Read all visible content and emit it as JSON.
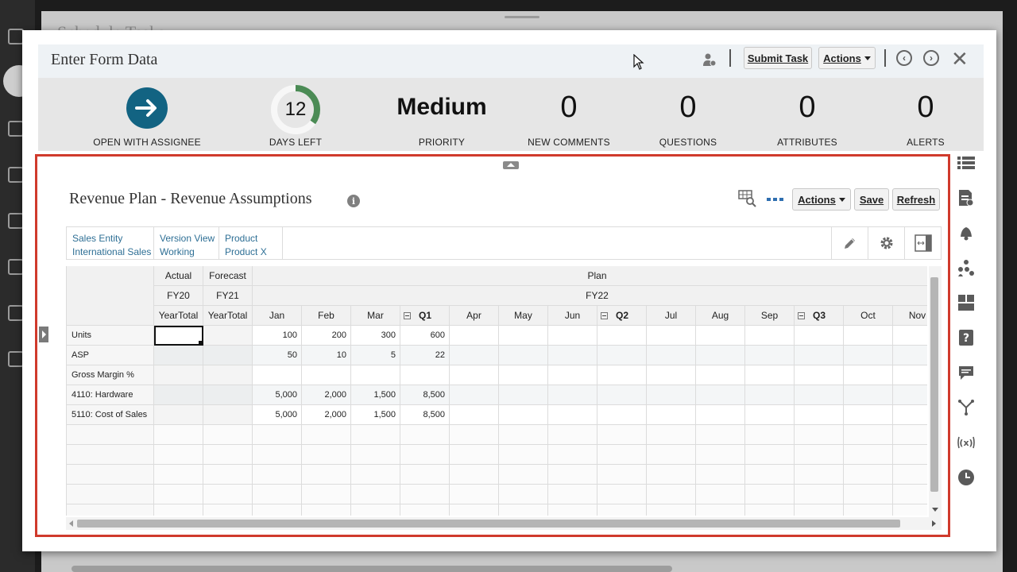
{
  "background": {
    "title": "Schedule Tasks"
  },
  "dialog": {
    "title": "Enter Form Data",
    "submit_label": "Submit Task",
    "actions_label": "Actions"
  },
  "stats": {
    "open_label": "OPEN WITH ASSIGNEE",
    "days_left": {
      "value": "12",
      "label": "DAYS LEFT",
      "fraction": 0.35
    },
    "priority": {
      "value": "Medium",
      "label": "PRIORITY"
    },
    "comments": {
      "value": "0",
      "label": "NEW COMMENTS"
    },
    "questions": {
      "value": "0",
      "label": "QUESTIONS"
    },
    "attributes": {
      "value": "0",
      "label": "ATTRIBUTES"
    },
    "alerts": {
      "value": "0",
      "label": "ALERTS"
    }
  },
  "form": {
    "title": "Revenue Plan - Revenue Assumptions",
    "actions_label": "Actions",
    "save_label": "Save",
    "refresh_label": "Refresh",
    "pov": [
      {
        "dim": "Sales Entity",
        "member": "International Sales"
      },
      {
        "dim": "Version View",
        "member": "Working"
      },
      {
        "dim": "Product",
        "member": "Product X"
      }
    ]
  },
  "grid": {
    "scenarios": [
      "Actual",
      "Forecast",
      "Plan"
    ],
    "years": [
      "FY20",
      "FY21",
      "FY22"
    ],
    "periods": [
      "YearTotal",
      "YearTotal",
      "Jan",
      "Feb",
      "Mar",
      "Q1",
      "Apr",
      "May",
      "Jun",
      "Q2",
      "Jul",
      "Aug",
      "Sep",
      "Q3",
      "Oct",
      "Nov"
    ],
    "rows": [
      {
        "label": "Units",
        "cells": [
          "",
          "",
          "100",
          "200",
          "300",
          "600",
          "",
          "",
          "",
          "",
          "",
          "",
          "",
          "",
          "",
          ""
        ]
      },
      {
        "label": "ASP",
        "cells": [
          "",
          "",
          "50",
          "10",
          "5",
          "22",
          "",
          "",
          "",
          "",
          "",
          "",
          "",
          "",
          "",
          ""
        ]
      },
      {
        "label": "Gross Margin %",
        "cells": [
          "",
          "",
          "",
          "",
          "",
          "",
          "",
          "",
          "",
          "",
          "",
          "",
          "",
          "",
          "",
          ""
        ]
      },
      {
        "label": "4110: Hardware",
        "cells": [
          "",
          "",
          "5,000",
          "2,000",
          "1,500",
          "8,500",
          "",
          "",
          "",
          "",
          "",
          "",
          "",
          "",
          "",
          ""
        ]
      },
      {
        "label": "5110: Cost of Sales",
        "cells": [
          "",
          "",
          "5,000",
          "2,000",
          "1,500",
          "8,500",
          "",
          "",
          "",
          "",
          "",
          "",
          "",
          "",
          "",
          ""
        ]
      }
    ]
  }
}
